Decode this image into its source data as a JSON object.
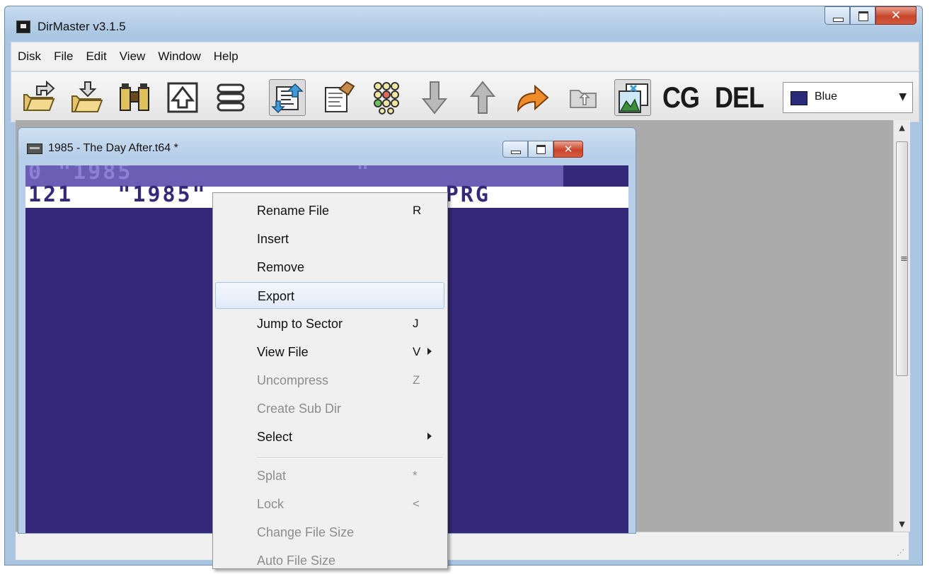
{
  "app": {
    "title": "DirMaster v3.1.5"
  },
  "menubar": [
    "Disk",
    "File",
    "Edit",
    "View",
    "Window",
    "Help"
  ],
  "toolbar": {
    "buttons": [
      {
        "icon": "open-folder-icon"
      },
      {
        "icon": "save-folder-icon"
      },
      {
        "icon": "binoculars-icon"
      },
      {
        "icon": "tree-icon"
      },
      {
        "icon": "list-icon"
      },
      {
        "icon": "sort-arrows-icon"
      },
      {
        "icon": "properties-icon"
      },
      {
        "icon": "dots-grid-icon"
      },
      {
        "icon": "arrow-down-icon"
      },
      {
        "icon": "arrow-up-icon"
      },
      {
        "icon": "arrow-right-icon"
      },
      {
        "icon": "folder-up-icon"
      },
      {
        "icon": "image-compare-icon"
      }
    ],
    "cg_label": "CG",
    "del_label": "DEL",
    "color_combo": {
      "value": "Blue",
      "swatch": "#2a2a7a"
    }
  },
  "child_window": {
    "title": "1985 - The Day After.t64 *",
    "header_row": "0 \"1985               \"",
    "file_row": "121   \"1985\"                PRG"
  },
  "context_menu": {
    "items": [
      {
        "label": "Rename File",
        "key": "R",
        "enabled": true
      },
      {
        "label": "Insert",
        "key": "",
        "enabled": true
      },
      {
        "label": "Remove",
        "key": "",
        "enabled": true
      },
      {
        "label": "Export",
        "key": "",
        "enabled": true,
        "hover": true
      },
      {
        "label": "Jump to Sector",
        "key": "J",
        "enabled": true
      },
      {
        "label": "View File",
        "key": "V",
        "enabled": true,
        "submenu": true
      },
      {
        "label": "Uncompress",
        "key": "Z",
        "enabled": false
      },
      {
        "label": "Create Sub Dir",
        "key": "",
        "enabled": false
      },
      {
        "label": "Select",
        "key": "",
        "enabled": true,
        "submenu": true
      },
      {
        "label": "Splat",
        "key": "*",
        "enabled": false
      },
      {
        "label": "Lock",
        "key": "<",
        "enabled": false
      },
      {
        "label": "Change File Size",
        "key": "",
        "enabled": false
      },
      {
        "label": "Auto File Size",
        "key": "",
        "enabled": false
      }
    ]
  },
  "colors": {
    "c64_background": "#352879",
    "c64_header": "#6c5eb5",
    "mdi_background": "#ababab"
  }
}
